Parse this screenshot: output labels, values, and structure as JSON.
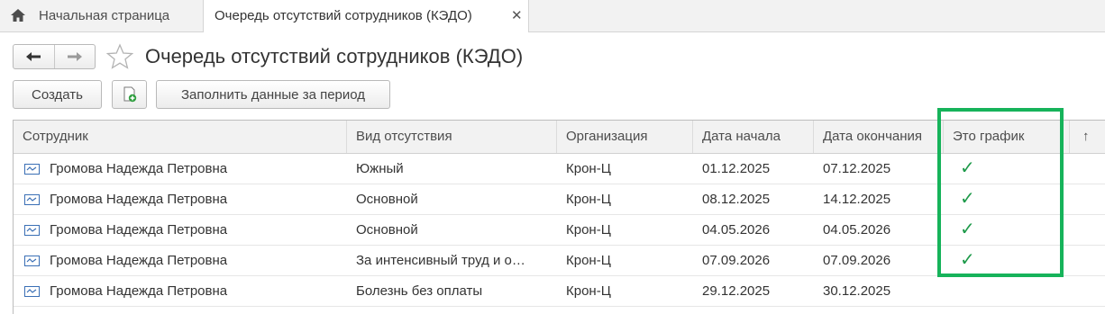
{
  "tabs": {
    "home": {
      "label": "Начальная страница",
      "icon": "home-icon"
    },
    "active": {
      "label": "Очередь отсутствий сотрудников (КЭДО)",
      "close_icon": "close-icon"
    }
  },
  "nav": {
    "back_icon": "arrow-left-icon",
    "forward_icon": "arrow-right-icon",
    "favorite_icon": "star-icon"
  },
  "page": {
    "title": "Очередь отсутствий сотрудников (КЭДО)"
  },
  "toolbar": {
    "create_label": "Создать",
    "copy_icon": "add-document-icon",
    "fill_label": "Заполнить данные за период"
  },
  "table": {
    "columns": {
      "employee": "Сотрудник",
      "absence_type": "Вид отсутствия",
      "organization": "Организация",
      "start_date": "Дата начала",
      "end_date": "Дата окончания",
      "is_schedule": "Это график",
      "sort": "↑"
    },
    "rows": [
      {
        "employee": "Громова Надежда Петровна",
        "absence_type": "Южный",
        "organization": "Крон-Ц",
        "start_date": "01.12.2025",
        "end_date": "07.12.2025",
        "is_schedule": "✓"
      },
      {
        "employee": "Громова Надежда Петровна",
        "absence_type": "Основной",
        "organization": "Крон-Ц",
        "start_date": "08.12.2025",
        "end_date": "14.12.2025",
        "is_schedule": "✓"
      },
      {
        "employee": "Громова Надежда Петровна",
        "absence_type": "Основной",
        "organization": "Крон-Ц",
        "start_date": "04.05.2026",
        "end_date": "04.05.2026",
        "is_schedule": "✓"
      },
      {
        "employee": "Громова Надежда Петровна",
        "absence_type": "За интенсивный труд и о…",
        "organization": "Крон-Ц",
        "start_date": "07.09.2026",
        "end_date": "07.09.2026",
        "is_schedule": "✓"
      },
      {
        "employee": "Громова Надежда Петровна",
        "absence_type": "Болезнь без оплаты",
        "organization": "Крон-Ц",
        "start_date": "29.12.2025",
        "end_date": "30.12.2025",
        "is_schedule": ""
      }
    ]
  },
  "colors": {
    "highlight": "#16b35a",
    "check": "#1e9a4a"
  }
}
